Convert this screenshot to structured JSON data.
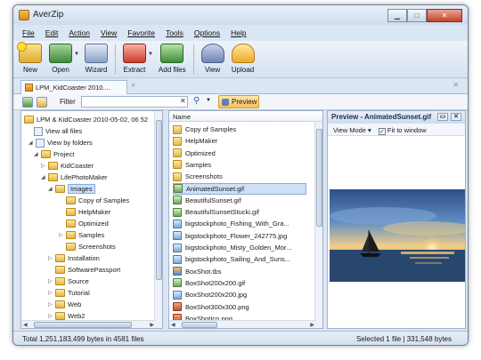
{
  "window": {
    "title": "AverZip",
    "controls": {
      "minimize": "▁",
      "maximize": "□",
      "close": "✕"
    }
  },
  "menu": [
    "File",
    "Edit",
    "Action",
    "View",
    "Favorite",
    "Tools",
    "Options",
    "Help"
  ],
  "toolbar": {
    "buttons": [
      {
        "label": "New",
        "icon": "new-archive-icon"
      },
      {
        "label": "Open",
        "icon": "open-archive-icon"
      },
      {
        "label": "Wizard",
        "icon": "wizard-icon"
      },
      {
        "label": "Extract",
        "icon": "extract-icon"
      },
      {
        "label": "Add files",
        "icon": "add-files-icon"
      },
      {
        "label": "View",
        "icon": "view-icon"
      },
      {
        "label": "Upload",
        "icon": "upload-icon"
      }
    ]
  },
  "tabs": {
    "active": "LPM_KidCoaster 2010....",
    "new_tab": "+",
    "close": "✕"
  },
  "filter": {
    "label": "Filter",
    "value": "",
    "clear": "✕",
    "preview_button": "Preview"
  },
  "tree": {
    "root": "LPM & KidCoaster 2010-05-02, 06 52",
    "view_all": "View all files",
    "view_by_folders": "View by folders",
    "items": [
      {
        "label": "Project",
        "level": 2,
        "arrow": "◢"
      },
      {
        "label": "KidCoaster",
        "level": 3,
        "arrow": "▷"
      },
      {
        "label": "LifePhotoMaker",
        "level": 3,
        "arrow": "◢"
      },
      {
        "label": "Images",
        "level": 4,
        "arrow": "◢",
        "selected": true
      },
      {
        "label": "Copy of Samples",
        "level": 5,
        "arrow": ""
      },
      {
        "label": "HelpMaker",
        "level": 5,
        "arrow": ""
      },
      {
        "label": "Optimized",
        "level": 5,
        "arrow": ""
      },
      {
        "label": "Samples",
        "level": 5,
        "arrow": "▷"
      },
      {
        "label": "Screenshots",
        "level": 5,
        "arrow": ""
      },
      {
        "label": "Installation",
        "level": 4,
        "arrow": "▷"
      },
      {
        "label": "SoftwarePassport",
        "level": 4,
        "arrow": ""
      },
      {
        "label": "Source",
        "level": 4,
        "arrow": "▷"
      },
      {
        "label": "Tutorial",
        "level": 4,
        "arrow": "▷"
      },
      {
        "label": "Web",
        "level": 4,
        "arrow": "▷"
      },
      {
        "label": "Web2",
        "level": 4,
        "arrow": "▷"
      }
    ]
  },
  "files": {
    "column": "Name",
    "items": [
      {
        "name": "Copy of Samples",
        "type": "folder"
      },
      {
        "name": "HelpMaker",
        "type": "folder"
      },
      {
        "name": "Optimized",
        "type": "folder"
      },
      {
        "name": "Samples",
        "type": "folder"
      },
      {
        "name": "Screenshots",
        "type": "folder"
      },
      {
        "name": "AnimatedSunset.gif",
        "type": "gif",
        "selected": true
      },
      {
        "name": "BeautifulSunset.gif",
        "type": "gif"
      },
      {
        "name": "BeautifulSunsetStucki.gif",
        "type": "gif"
      },
      {
        "name": "bigstockphoto_Fishing_With_Gra...",
        "type": "image"
      },
      {
        "name": "bigstockphoto_Flower_242775.jpg",
        "type": "image"
      },
      {
        "name": "bigstockphoto_Misty_Golden_Mor...",
        "type": "image"
      },
      {
        "name": "bigstockphoto_Sailing_And_Suns...",
        "type": "image"
      },
      {
        "name": "BoxShot.tbs",
        "type": "box"
      },
      {
        "name": "BoxShot200x200.gif",
        "type": "gif"
      },
      {
        "name": "BoxShot200x200.jpg",
        "type": "image"
      },
      {
        "name": "BoxShot300x300.png",
        "type": "png"
      },
      {
        "name": "BoxShotIco.png",
        "type": "png"
      }
    ]
  },
  "preview": {
    "title": "Preview - AnimatedSunset.gif",
    "view_mode": "View Mode",
    "fit_to_window": "Fit to window",
    "fit_checked": true
  },
  "status": {
    "left": "Total 1,251,183,499 bytes in 4581 files",
    "right": "Selected 1 file | 331,548 bytes"
  },
  "colors": {
    "window_bg": "#dbe6f4",
    "selection": "#cde0f7",
    "preview_button": "#f6c05a"
  }
}
